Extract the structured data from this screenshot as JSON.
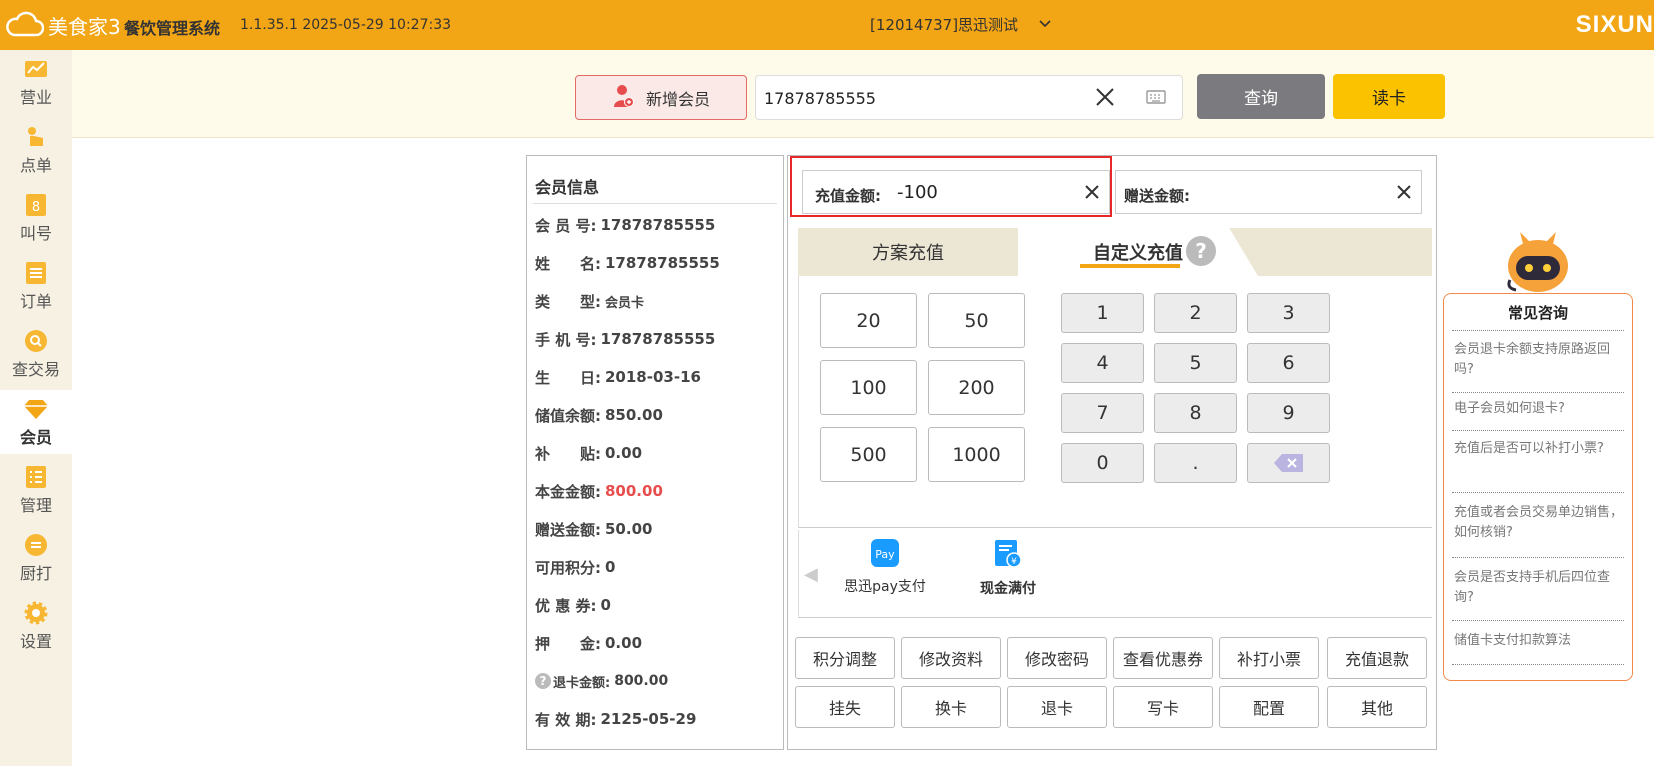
{
  "app": {
    "logo_text": "美食家3",
    "system_name": "餐饮管理系统",
    "version": "1.1.35.1 2025-05-29 10:27:33",
    "store": "[12014737]思迅测试",
    "brand": "SIXUN"
  },
  "sidebar": {
    "items": [
      {
        "label": "营业",
        "icon": "chart-icon"
      },
      {
        "label": "点单",
        "icon": "hand-icon"
      },
      {
        "label": "叫号",
        "icon": "number-icon"
      },
      {
        "label": "订单",
        "icon": "list-icon"
      },
      {
        "label": "查交易",
        "icon": "search-icon"
      },
      {
        "label": "会员",
        "icon": "diamond-icon"
      },
      {
        "label": "管理",
        "icon": "manage-icon"
      },
      {
        "label": "厨打",
        "icon": "printer-icon"
      },
      {
        "label": "设置",
        "icon": "gear-icon"
      }
    ],
    "active": "会员"
  },
  "search": {
    "add_member": "新增会员",
    "phone_value": "17878785555",
    "query": "查询",
    "read_card": "读卡"
  },
  "member": {
    "title": "会员信息",
    "rows": [
      {
        "k": "会 员 号:",
        "v": "17878785555"
      },
      {
        "k": "姓　　名:",
        "v": "17878785555"
      },
      {
        "k": "类　　型:",
        "v": "会员卡"
      },
      {
        "k": "手 机 号:",
        "v": "17878785555"
      },
      {
        "k": "生　　日:",
        "v": "2018-03-16"
      },
      {
        "k": "储值余额:",
        "v": "850.00"
      },
      {
        "k": "补　　贴:",
        "v": "0.00"
      },
      {
        "k": "本金金额:",
        "v": "800.00"
      },
      {
        "k": "赠送金额:",
        "v": "50.00"
      },
      {
        "k": "可用积分:",
        "v": "0"
      },
      {
        "k": "优 惠 券:",
        "v": "0"
      },
      {
        "k": "押　　金:",
        "v": "0.00"
      },
      {
        "k": "退卡金额:",
        "v": "800.00"
      },
      {
        "k": "有 效 期:",
        "v": "2125-05-29"
      }
    ]
  },
  "recharge": {
    "amount_label": "充值金额:",
    "amount_value": "-100",
    "gift_label": "赠送金额:",
    "tabs": [
      "方案充值",
      "自定义充值"
    ],
    "active_tab": "自定义充值",
    "presets": [
      "20",
      "50",
      "100",
      "200",
      "500",
      "1000"
    ],
    "keys": [
      "1",
      "2",
      "3",
      "4",
      "5",
      "6",
      "7",
      "8",
      "9",
      "0",
      "."
    ],
    "payments": [
      {
        "label": "思迅pay支付",
        "icon": "pay-icon"
      },
      {
        "label": "现金满付",
        "icon": "cash-icon"
      }
    ],
    "actions_row1": [
      "积分调整",
      "修改资料",
      "修改密码",
      "查看优惠券",
      "补打小票",
      "充值退款"
    ],
    "actions_row2": [
      "挂失",
      "换卡",
      "退卡",
      "写卡",
      "配置",
      "其他"
    ]
  },
  "faq": {
    "title": "常见咨询",
    "items": [
      "会员退卡余额支持原路返回吗?",
      "电子会员如何退卡?",
      "充值后是否可以补打小票?",
      "充值或者会员交易单边销售，如何核销?",
      "会员是否支持手机后四位查询?",
      "储值卡支付扣款算法"
    ]
  },
  "colors": {
    "topbar": "#f2a515",
    "accent_red": "#e84d4d",
    "read_card": "#fbc200",
    "query": "#7a7a7f"
  }
}
